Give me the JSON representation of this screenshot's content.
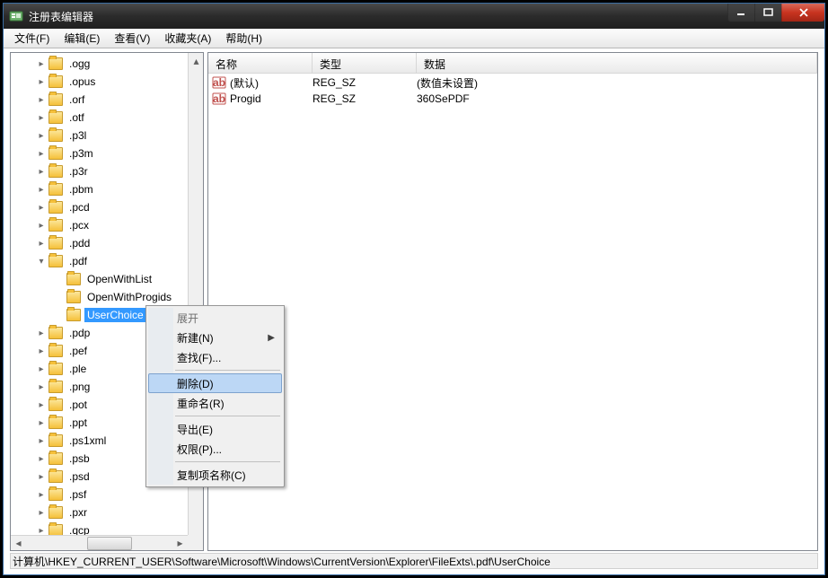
{
  "window": {
    "title": "注册表编辑器"
  },
  "menubar": [
    {
      "label": "文件(F)"
    },
    {
      "label": "编辑(E)"
    },
    {
      "label": "查看(V)"
    },
    {
      "label": "收藏夹(A)"
    },
    {
      "label": "帮助(H)"
    }
  ],
  "tree": {
    "items": [
      {
        "label": ".ogg",
        "level": 1,
        "exp": "closed"
      },
      {
        "label": ".opus",
        "level": 1,
        "exp": "closed"
      },
      {
        "label": ".orf",
        "level": 1,
        "exp": "closed"
      },
      {
        "label": ".otf",
        "level": 1,
        "exp": "closed"
      },
      {
        "label": ".p3l",
        "level": 1,
        "exp": "closed"
      },
      {
        "label": ".p3m",
        "level": 1,
        "exp": "closed"
      },
      {
        "label": ".p3r",
        "level": 1,
        "exp": "closed"
      },
      {
        "label": ".pbm",
        "level": 1,
        "exp": "closed"
      },
      {
        "label": ".pcd",
        "level": 1,
        "exp": "closed"
      },
      {
        "label": ".pcx",
        "level": 1,
        "exp": "closed"
      },
      {
        "label": ".pdd",
        "level": 1,
        "exp": "closed"
      },
      {
        "label": ".pdf",
        "level": 1,
        "exp": "open"
      },
      {
        "label": "OpenWithList",
        "level": 2,
        "exp": "none"
      },
      {
        "label": "OpenWithProgids",
        "level": 2,
        "exp": "none"
      },
      {
        "label": "UserChoice",
        "level": 2,
        "exp": "none",
        "selected": true
      },
      {
        "label": ".pdp",
        "level": 1,
        "exp": "closed"
      },
      {
        "label": ".pef",
        "level": 1,
        "exp": "closed"
      },
      {
        "label": ".ple",
        "level": 1,
        "exp": "closed"
      },
      {
        "label": ".png",
        "level": 1,
        "exp": "closed"
      },
      {
        "label": ".pot",
        "level": 1,
        "exp": "closed"
      },
      {
        "label": ".ppt",
        "level": 1,
        "exp": "closed"
      },
      {
        "label": ".ps1xml",
        "level": 1,
        "exp": "closed"
      },
      {
        "label": ".psb",
        "level": 1,
        "exp": "closed"
      },
      {
        "label": ".psd",
        "level": 1,
        "exp": "closed"
      },
      {
        "label": ".psf",
        "level": 1,
        "exp": "closed"
      },
      {
        "label": ".pxr",
        "level": 1,
        "exp": "closed"
      },
      {
        "label": ".qcp",
        "level": 1,
        "exp": "closed"
      }
    ]
  },
  "list": {
    "headers": {
      "name": "名称",
      "type": "类型",
      "data": "数据"
    },
    "rows": [
      {
        "name": "(默认)",
        "type": "REG_SZ",
        "data": "(数值未设置)"
      },
      {
        "name": "Progid",
        "type": "REG_SZ",
        "data": "360SePDF"
      }
    ]
  },
  "status": {
    "path": "计算机\\HKEY_CURRENT_USER\\Software\\Microsoft\\Windows\\CurrentVersion\\Explorer\\FileExts\\.pdf\\UserChoice"
  },
  "contextmenu": {
    "items": [
      {
        "label": "展开",
        "type": "item",
        "disabled": true
      },
      {
        "label": "新建(N)",
        "type": "submenu"
      },
      {
        "label": "查找(F)...",
        "type": "item"
      },
      {
        "type": "sep"
      },
      {
        "label": "删除(D)",
        "type": "item",
        "hover": true
      },
      {
        "label": "重命名(R)",
        "type": "item"
      },
      {
        "type": "sep"
      },
      {
        "label": "导出(E)",
        "type": "item"
      },
      {
        "label": "权限(P)...",
        "type": "item"
      },
      {
        "type": "sep"
      },
      {
        "label": "复制项名称(C)",
        "type": "item"
      }
    ]
  }
}
